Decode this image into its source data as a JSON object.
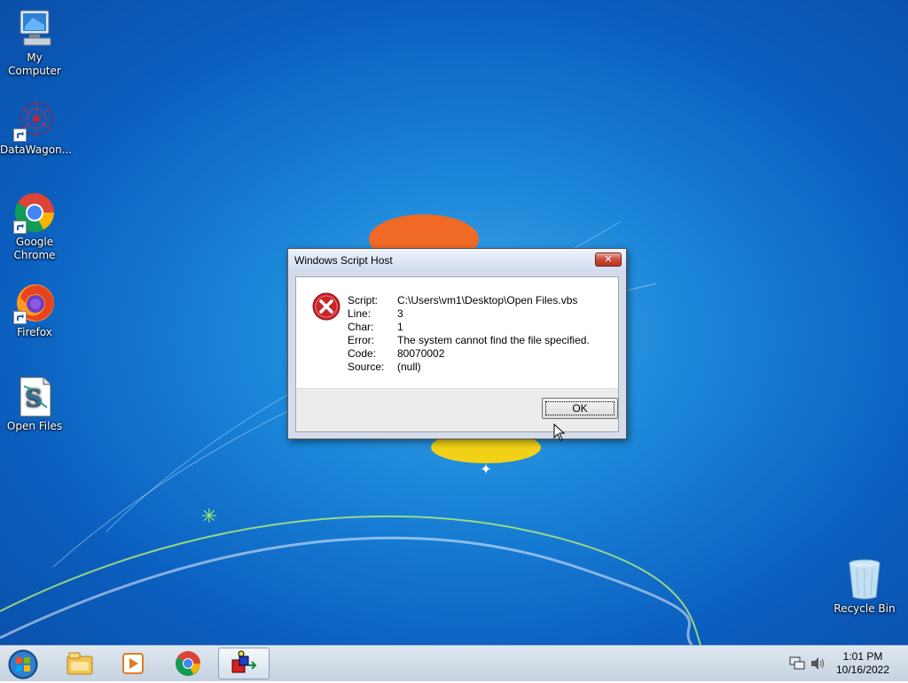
{
  "desktop": {
    "icons": [
      {
        "label": "My Computer",
        "icon": "computer-icon"
      },
      {
        "label": "DataWagon...",
        "icon": "datawagon-icon"
      },
      {
        "label": "Google Chrome",
        "icon": "chrome-icon"
      },
      {
        "label": "Firefox",
        "icon": "firefox-icon"
      },
      {
        "label": "Open Files",
        "icon": "script-file-icon"
      },
      {
        "label": "Recycle Bin",
        "icon": "recycle-bin-icon"
      }
    ]
  },
  "dialog": {
    "title": "Windows Script Host",
    "close_symbol": "✕",
    "fields": [
      {
        "label": "Script:",
        "value": "C:\\Users\\vm1\\Desktop\\Open Files.vbs"
      },
      {
        "label": "Line:",
        "value": "3"
      },
      {
        "label": "Char:",
        "value": "1"
      },
      {
        "label": "Error:",
        "value": "The system cannot find the file specified."
      },
      {
        "label": "Code:",
        "value": "80070002"
      },
      {
        "label": "Source:",
        "value": "(null)"
      }
    ],
    "ok_label": "OK",
    "icon": "error-icon"
  },
  "taskbar": {
    "items": [
      "start-orb-icon",
      "file-explorer-icon",
      "media-player-icon",
      "chrome-icon",
      "script-host-icon"
    ],
    "tray_icons": [
      "network-icon",
      "volume-icon"
    ],
    "time": "1:01 PM",
    "date": "10/16/2022"
  },
  "colors": {
    "desktop_bg": "#1a84d8",
    "error_red": "#c9252b",
    "taskbar": "#d4dde8"
  }
}
